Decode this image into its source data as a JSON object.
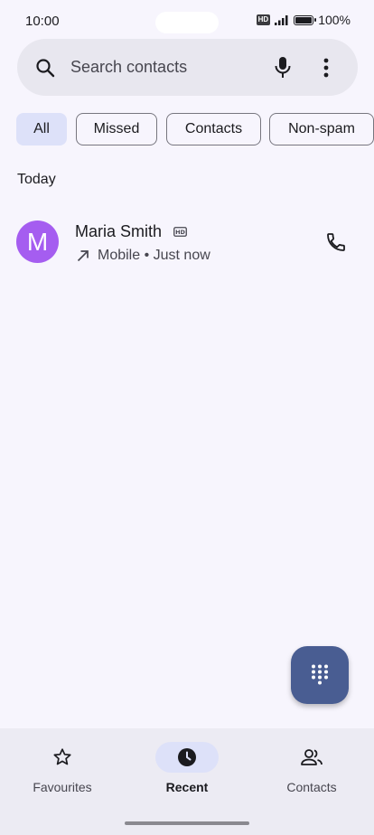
{
  "status_bar": {
    "time": "10:00",
    "network_badge": "HD",
    "battery": "100%"
  },
  "search": {
    "placeholder": "Search contacts",
    "icons": [
      "search-icon",
      "mic-icon",
      "more-vert-icon"
    ]
  },
  "filters": [
    {
      "label": "All",
      "selected": true
    },
    {
      "label": "Missed",
      "selected": false
    },
    {
      "label": "Contacts",
      "selected": false
    },
    {
      "label": "Non-spam",
      "selected": false
    }
  ],
  "section_header": "Today",
  "calls": [
    {
      "initial": "M",
      "name": "Maria Smith",
      "type": "Mobile",
      "time": "Just now",
      "direction": "outgoing",
      "avatar_color": "#a55df0"
    }
  ],
  "fab": {
    "icon": "dialpad-icon"
  },
  "bottom_nav": [
    {
      "label": "Favourites",
      "icon": "star-icon",
      "active": false
    },
    {
      "label": "Recent",
      "icon": "clock-icon",
      "active": true
    },
    {
      "label": "Contacts",
      "icon": "people-icon",
      "active": false
    }
  ],
  "colors": {
    "accent": "#495d92",
    "selected_chip": "#dde1f9",
    "background": "#f7f5fd"
  }
}
